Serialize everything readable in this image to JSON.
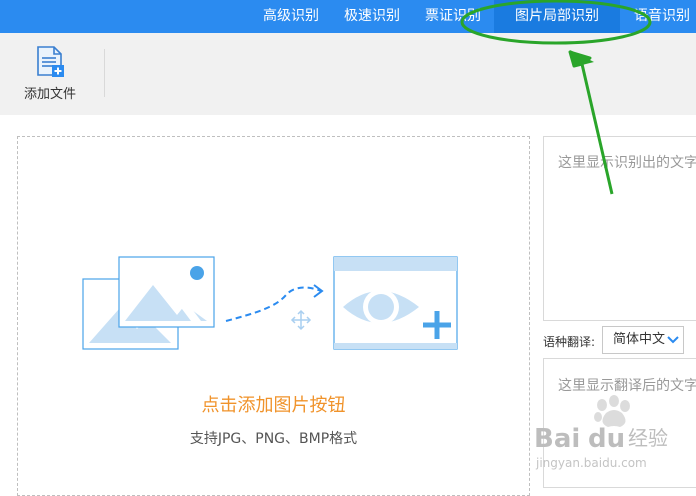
{
  "nav": {
    "tabs": [
      {
        "label": "高级识别"
      },
      {
        "label": "极速识别"
      },
      {
        "label": "票证识别"
      },
      {
        "label": "图片局部识别"
      },
      {
        "label": "语音识别"
      }
    ],
    "active_tab": "图片局部识别"
  },
  "toolbar": {
    "add_file_label": "添加文件"
  },
  "dropzone": {
    "title": "点击添加图片按钮",
    "subtitle": "支持JPG、PNG、BMP格式"
  },
  "result": {
    "placeholder": "这里显示识别出的文字"
  },
  "translate": {
    "label": "语种翻译:",
    "selected_language": "简体中文",
    "placeholder": "这里显示翻译后的文字"
  },
  "watermark": {
    "text": "Baidu经验",
    "url_text": "jingyan.baidu.com"
  },
  "colors": {
    "nav_bg": "#2b8bf0",
    "hint_orange": "#f0932b",
    "annotation_green": "#2aa52a",
    "icon_blue": "#4aa3e8"
  }
}
